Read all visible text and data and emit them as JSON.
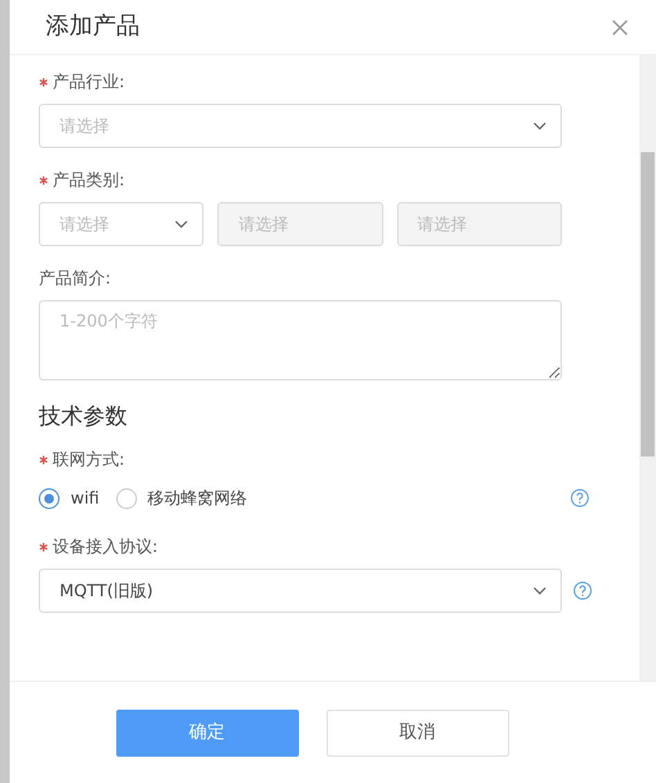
{
  "dialog": {
    "title": "添加产品"
  },
  "fields": [
    {
      "kind": "select",
      "label": "产品行业:",
      "required": true,
      "placeholder": "请选择"
    },
    {
      "kind": "select-group",
      "label": "产品类别:",
      "required": true,
      "selects": [
        {
          "placeholder": "请选择",
          "disabled": false
        },
        {
          "placeholder": "请选择",
          "disabled": true
        },
        {
          "placeholder": "请选择",
          "disabled": true
        }
      ]
    },
    {
      "kind": "textarea",
      "label": "产品简介:",
      "required": false,
      "placeholder": "1-200个字符"
    },
    {
      "kind": "heading",
      "text": "技术参数"
    },
    {
      "kind": "radio",
      "label": "联网方式:",
      "required": true,
      "help": true,
      "options": [
        {
          "label": "wifi",
          "selected": true
        },
        {
          "label": "移动蜂窝网络",
          "selected": false
        }
      ]
    },
    {
      "kind": "select",
      "label": "设备接入协议:",
      "required": true,
      "help": true,
      "value": "MQTT(旧版)"
    }
  ],
  "buttons": [
    {
      "label": "确定",
      "kind": "primary"
    },
    {
      "label": "取消",
      "kind": "default"
    }
  ]
}
